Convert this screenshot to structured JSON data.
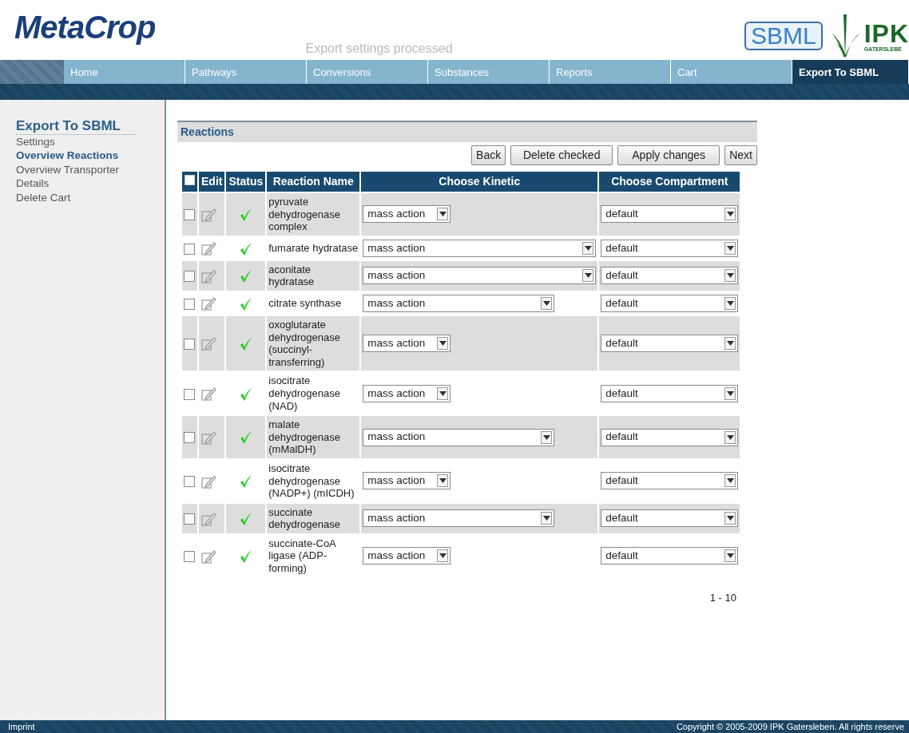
{
  "header": {
    "logo": "MetaCrop",
    "message": "Export settings processed",
    "sbml_logo": "SBML",
    "ipk_logo": {
      "name": "IPK",
      "place": "GATERSLEBE"
    }
  },
  "nav": [
    {
      "label": "Home",
      "selected": false
    },
    {
      "label": "Pathways",
      "selected": false
    },
    {
      "label": "Conversions",
      "selected": false
    },
    {
      "label": "Substances",
      "selected": false
    },
    {
      "label": "Reports",
      "selected": false
    },
    {
      "label": "Cart",
      "selected": false
    },
    {
      "label": "Export To SBML",
      "selected": true
    }
  ],
  "sidebar": {
    "title": "Export To SBML",
    "items": [
      {
        "label": "Settings",
        "selected": false
      },
      {
        "label": "Overview Reactions",
        "selected": true
      },
      {
        "label": "Overview Transporter",
        "selected": false
      },
      {
        "label": "Details",
        "selected": false
      },
      {
        "label": "Delete Cart",
        "selected": false
      }
    ]
  },
  "panel": {
    "title": "Reactions",
    "buttons": [
      "Back",
      "Delete checked",
      "Apply changes",
      "Next"
    ],
    "columns": [
      "Edit",
      "Status",
      "Reaction Name",
      "Choose Kinetic",
      "Choose Compartment"
    ],
    "select_all_checked": false,
    "rows": [
      {
        "checked": false,
        "valid": true,
        "name": "pyruvate dehydrogenase complex",
        "kinetic": "mass action",
        "compartment": "default"
      },
      {
        "checked": false,
        "valid": true,
        "name": "fumarate hydratase",
        "kinetic": "mass action",
        "compartment": "default"
      },
      {
        "checked": false,
        "valid": true,
        "name": "aconitate hydratase",
        "kinetic": "mass action",
        "compartment": "default"
      },
      {
        "checked": false,
        "valid": true,
        "name": "citrate synthase",
        "kinetic": "mass action",
        "compartment": "default"
      },
      {
        "checked": false,
        "valid": true,
        "name": "oxoglutarate dehydrogenase (succinyl-transferring)",
        "kinetic": "mass action",
        "compartment": "default"
      },
      {
        "checked": false,
        "valid": true,
        "name": "isocitrate dehydrogenase (NAD)",
        "kinetic": "mass action",
        "compartment": "default"
      },
      {
        "checked": false,
        "valid": true,
        "name": "malate dehydrogenase (mMalDH)",
        "kinetic": "mass action",
        "compartment": "default"
      },
      {
        "checked": false,
        "valid": true,
        "name": "isocitrate dehydrogenase (NADP+) (mICDH)",
        "kinetic": "mass action",
        "compartment": "default"
      },
      {
        "checked": false,
        "valid": true,
        "name": "succinate dehydrogenase",
        "kinetic": "mass action",
        "compartment": "default"
      },
      {
        "checked": false,
        "valid": true,
        "name": "succinate-CoA ligase (ADP-forming)",
        "kinetic": "mass action",
        "compartment": "default"
      }
    ],
    "pager": "1 - 10"
  },
  "footer": {
    "link": "Imprint",
    "copyright": "Copyright © 2005-2009 IPK Gatersleben. All rights reserve"
  }
}
